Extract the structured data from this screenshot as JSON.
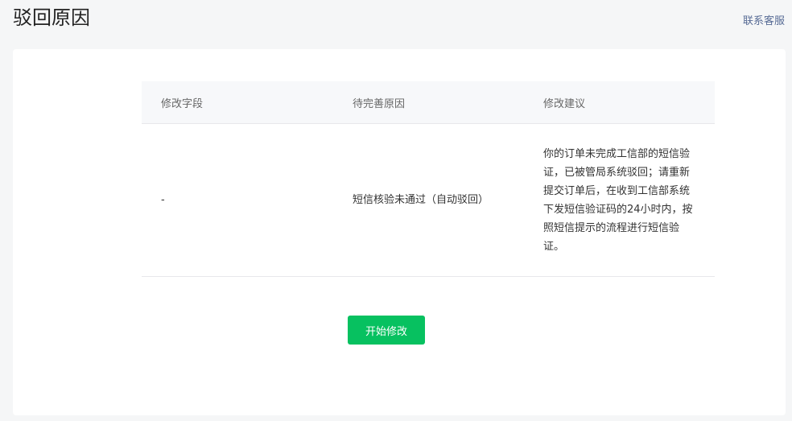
{
  "header": {
    "title": "驳回原因",
    "contact_label": "联系客服"
  },
  "table": {
    "columns": [
      "修改字段",
      "待完善原因",
      "修改建议"
    ],
    "rows": [
      {
        "field": "-",
        "reason": "短信核验未通过（自动驳回）",
        "suggestion": "你的订单未完成工信部的短信验证，已被管局系统驳回；请重新提交订单后，在收到工信部系统下发短信验证码的24小时内，按照短信提示的流程进行短信验证。"
      }
    ]
  },
  "actions": {
    "start_label": "开始修改"
  },
  "colors": {
    "primary": "#07c160",
    "link": "#576b95",
    "background": "#f5f6f7"
  }
}
